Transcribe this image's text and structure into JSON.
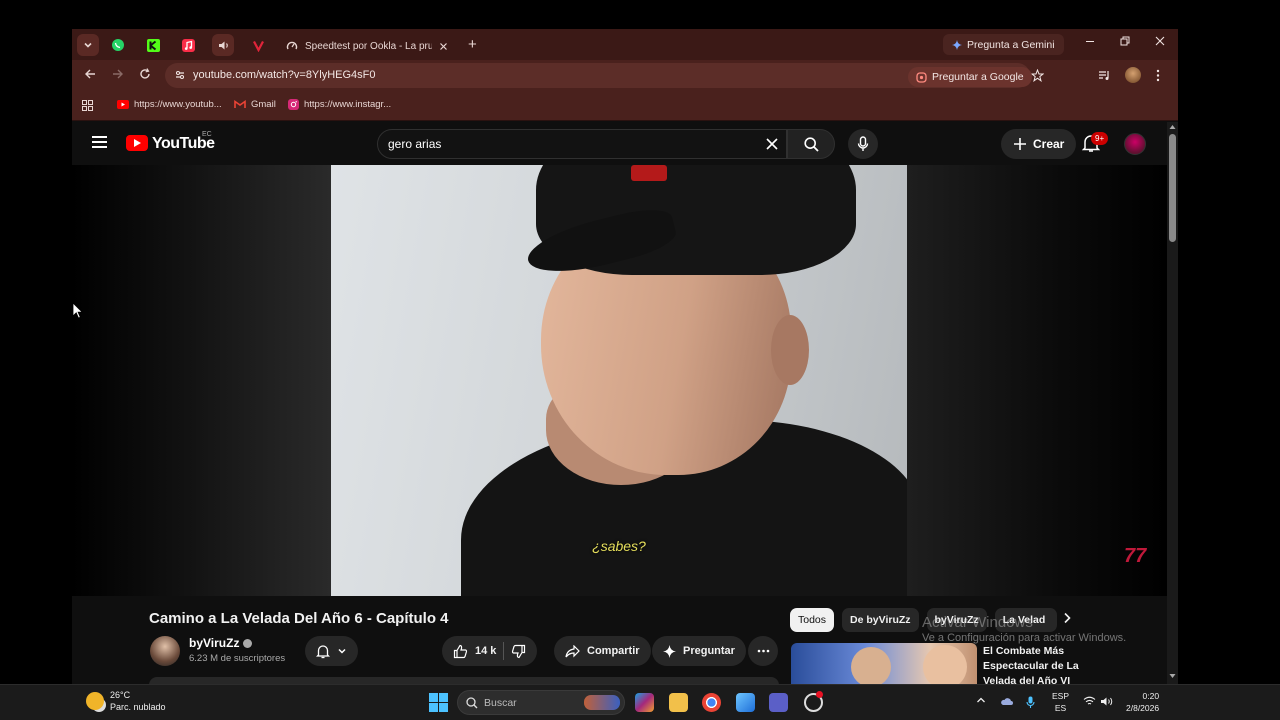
{
  "browser": {
    "tabs": {
      "active_title": "Speedtest por Ookla - La prueb",
      "new_tab_glyph": "+"
    },
    "gemini_button": "Pregunta a Gemini",
    "url": "youtube.com/watch?v=8YlyHEG4sF0",
    "ask_google_button": "Preguntar a Google",
    "bookmarks": [
      {
        "label": "https://www.youtub...",
        "icon": "youtube-icon"
      },
      {
        "label": "Gmail",
        "icon": "gmail-icon"
      },
      {
        "label": "https://www.instagr...",
        "icon": "instagram-icon"
      }
    ]
  },
  "youtube": {
    "logo_text": "YouTube",
    "country_code": "EC",
    "search_value": "gero arias",
    "create_label": "Crear",
    "notifications_badge": "9+",
    "video": {
      "subtitle": "¿sabes?",
      "title": "Camino a La Velada Del Año 6 - Capítulo 4",
      "watermark": "77"
    },
    "channel": {
      "name": "byViruZz",
      "subscribers": "6.23 M de suscriptores"
    },
    "actions": {
      "likes": "14 k",
      "share": "Compartir",
      "ask": "Preguntar"
    },
    "chips": [
      "Todos",
      "De byViruZz",
      "byViruZz",
      "La Velad"
    ],
    "recommendation": {
      "title": "El Combate Más Espectacular de La Velada del Año VI"
    }
  },
  "windows_activation": {
    "line1": "Activar Windows",
    "line2": "Ve a Configuración para activar Windows."
  },
  "taskbar": {
    "weather_temp": "26°C",
    "weather_desc": "Parc. nublado",
    "search_placeholder": "Buscar",
    "lang_1": "ESP",
    "lang_2": "ES",
    "time": "0:20",
    "date": "2/8/2026"
  },
  "colors": {
    "tab_bar": "#3b1916",
    "toolbar": "#4a211d",
    "youtube_bg": "#0f0f0f",
    "youtube_red": "#ff0000",
    "subtitle_yellow": "#e6df5c"
  }
}
